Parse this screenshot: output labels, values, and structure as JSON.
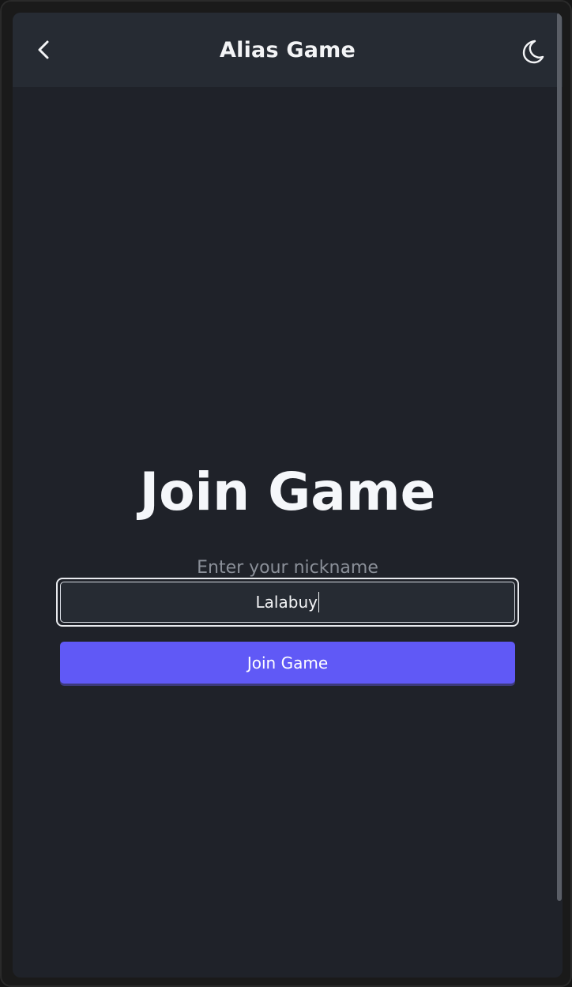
{
  "header": {
    "title": "Alias Game",
    "back_icon": "chevron-left-icon",
    "theme_icon": "moon-icon"
  },
  "main": {
    "heading": "Join Game",
    "nickname_label": "Enter your nickname",
    "nickname_value": "Lalabuy",
    "join_button_label": "Join Game"
  },
  "colors": {
    "background": "#1f2229",
    "header": "#262b33",
    "accent": "#6059f6",
    "text": "#f3f4f6",
    "muted_text": "#8a8f98"
  }
}
